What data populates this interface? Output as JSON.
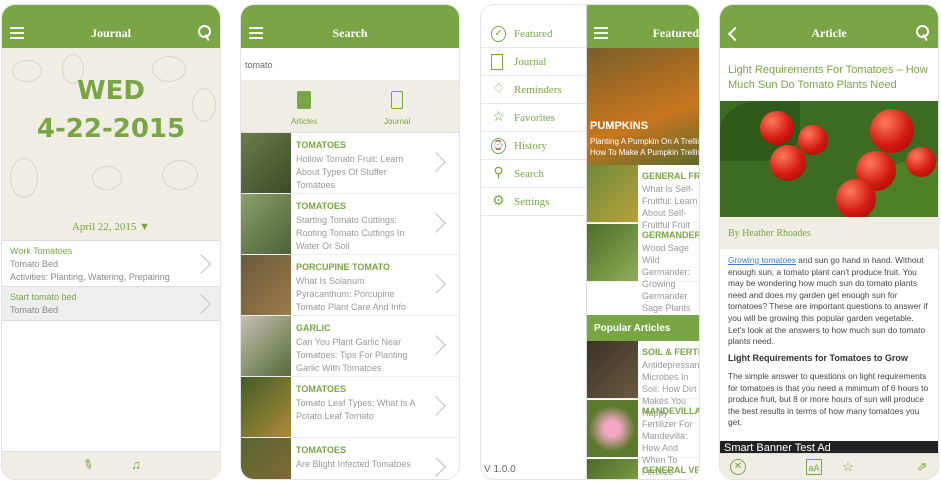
{
  "screen1": {
    "header_title": "Journal",
    "day": "WED",
    "date": "4-22-2015",
    "date_select": "April 22, 2015 ▼",
    "entries": [
      {
        "title": "Work Tomatoes",
        "sub": "Tomato Bed",
        "activities": "Activities: Planting, Watering, Prepairing"
      },
      {
        "title": "Start tomato bed",
        "sub": "Tomato Bed",
        "activities": ""
      }
    ]
  },
  "screen2": {
    "header_title": "Search",
    "query": "tomato",
    "seg_articles": "Articles",
    "seg_journal": "Journal",
    "results": [
      {
        "keyword": "TOMATOES",
        "desc": "Hollow Tomato Fruit: Learn About Types Of Stuffer Tomatoes"
      },
      {
        "keyword": "TOMATOES",
        "desc": "Starting Tomato Cuttings: Rooting Tomato Cuttings In Water Or Soil"
      },
      {
        "keyword": "PORCUPINE TOMATO",
        "desc": "What Is Solanum Pyracanthum: Porcupine Tomato Plant Care And Info"
      },
      {
        "keyword": "GARLIC",
        "desc": "Can You Plant Garlic Near Tomatoes: Tips For Planting Garlic With Tomatoes"
      },
      {
        "keyword": "TOMATOES",
        "desc": "Tomato Leaf Types: What Is A Potato Leaf Tomato"
      },
      {
        "keyword": "TOMATOES",
        "desc": "Are Blight Infected Tomatoes"
      }
    ]
  },
  "screen3": {
    "header_title": "Featured",
    "menu": [
      {
        "label": "Featured",
        "icon": "check-icon"
      },
      {
        "label": "Journal",
        "icon": "notebook-icon"
      },
      {
        "label": "Reminders",
        "icon": "bell-icon"
      },
      {
        "label": "Favorites",
        "icon": "star-icon"
      },
      {
        "label": "History",
        "icon": "clock-icon"
      },
      {
        "label": "Search",
        "icon": "search-icon"
      },
      {
        "label": "Settings",
        "icon": "gear-icon"
      }
    ],
    "version": "V 1.0.0",
    "hero": {
      "kw": "PUMPKINS",
      "desc": "Planting A Pumpkin On A Trellis: How To Make A Pumpkin Trellis"
    },
    "featured": [
      {
        "kw": "GENERAL FRUIT",
        "desc": "What Is Self-Fruitful: Learn About Self-Fruitful Fruit"
      },
      {
        "kw": "GERMANDER",
        "desc": "Wood Sage Wild Germander: Growing Germander Sage Plants"
      }
    ],
    "popular_title": "Popular Articles",
    "popular": [
      {
        "kw": "SOIL & FERTILIZERS",
        "desc": "Antidepressant Microbes In Soil: How Dirt Makes You Happy"
      },
      {
        "kw": "MANDEVILLA",
        "desc": "Fertilizer For Mandevilla: How And When To Fertilize Mandevilla Plants"
      },
      {
        "kw": "GENERAL VEGETABLE",
        "desc": ""
      }
    ]
  },
  "screen4": {
    "header_title": "Article",
    "title": "Light Requirements For Tomatoes – How Much Sun Do Tomato Plants Need",
    "byline": "By Heather Rhoades",
    "link": "Growing tomatoes",
    "p1": " and sun go hand in hand. Without enough sun, a tomato plant can't produce fruit. You may be wondering how much sun do tomato plants need and does my garden get enough sun for tomatoes? These are important questions to answer if you will be growing this popular garden vegetable. Let's look at the answers to how much sun do tomato plants need.",
    "subhead": "Light Requirements for Tomatoes to Grow",
    "p2": "The simple answer to questions on light requirements for tomatoes is that you need a minimum of 6 hours to produce fruit, but 8 or more hours of sun will produce the best results in terms of how many tomatoes you get.",
    "ad": "Smart Banner Test Ad"
  }
}
